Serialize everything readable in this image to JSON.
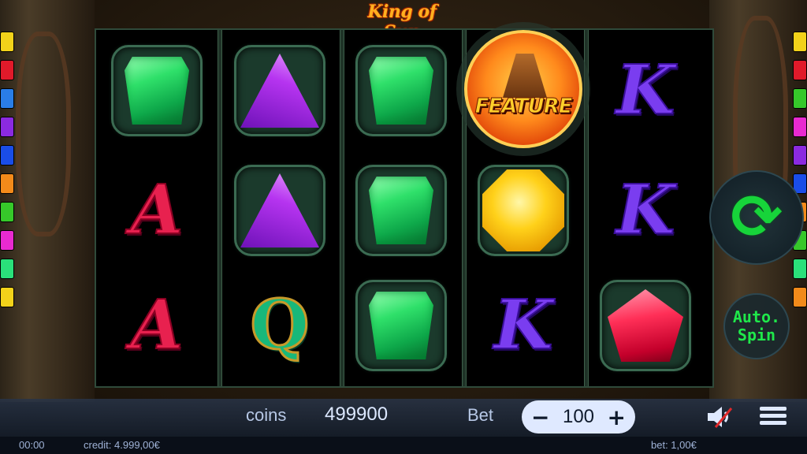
{
  "game": {
    "title": "King of Sun"
  },
  "colors": {
    "accent_green": "#17d43a",
    "pill_bg": "#dfe9ff",
    "bar_text": "#b7c8e6"
  },
  "reels": [
    [
      "gem-green",
      "letter-a",
      "letter-a"
    ],
    [
      "gem-purple",
      "gem-purple",
      "letter-q"
    ],
    [
      "gem-green",
      "gem-green",
      "gem-green"
    ],
    [
      "feature",
      "gem-yellow",
      "letter-k"
    ],
    [
      "letter-k",
      "letter-k",
      "gem-red"
    ]
  ],
  "symbols": {
    "feature_label": "FEATURE",
    "letter_a": "A",
    "letter_k": "K",
    "letter_q": "Q"
  },
  "controls": {
    "spin_icon": "refresh-arrows-icon",
    "auto_line1": "Auto.",
    "auto_line2": "Spin"
  },
  "bottom_bar": {
    "coins_label": "coins",
    "coins_value": "499900",
    "bet_label": "Bet",
    "bet_minus": "−",
    "bet_value": "100",
    "bet_plus": "+",
    "sound_icon": "sound-muted-icon",
    "menu_icon": "hamburger-menu-icon"
  },
  "status_bar": {
    "time": "00:00",
    "credit": "credit: 4.999,00€",
    "bet": "bet: 1,00€"
  },
  "side_tabs": {
    "left": [
      "#f2d21a",
      "#e01a2a",
      "#2a7de8",
      "#8b2ae0",
      "#1a4de8",
      "#f28a1a",
      "#36c82a",
      "#e82ad0",
      "#2ae07a",
      "#f2d21a"
    ],
    "right": [
      "#f2d21a",
      "#e01a2a",
      "#36c82a",
      "#e82ad0",
      "#8b2ae0",
      "#1a4de8",
      "#f28a1a",
      "#36c82a",
      "#2ae07a",
      "#f28a1a"
    ]
  }
}
